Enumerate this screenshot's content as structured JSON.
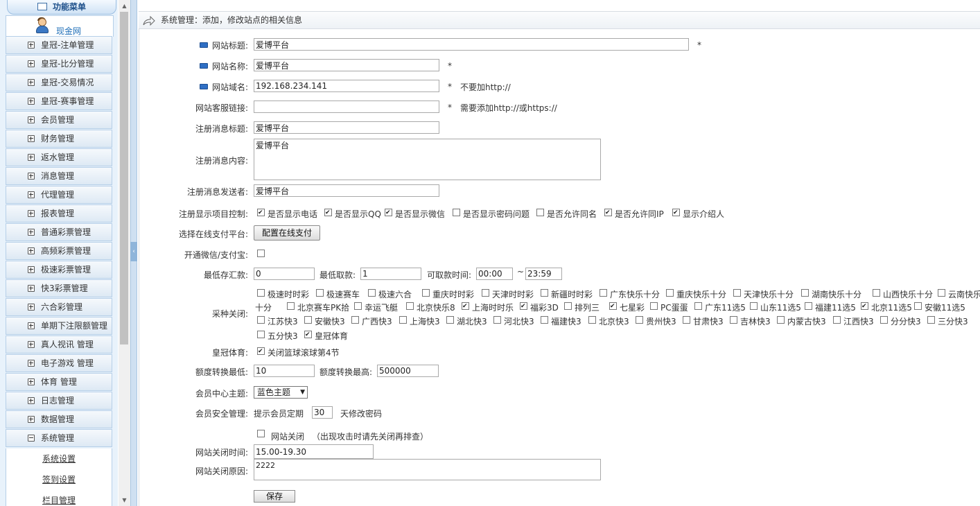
{
  "sidebar": {
    "header": "功能菜单",
    "user_name": "现金网",
    "items": [
      {
        "label": "皇冠-注单管理",
        "expanded": false
      },
      {
        "label": "皇冠-比分管理",
        "expanded": false
      },
      {
        "label": "皇冠-交易情况",
        "expanded": false
      },
      {
        "label": "皇冠-赛事管理",
        "expanded": false
      },
      {
        "label": "会员管理",
        "expanded": false
      },
      {
        "label": "财务管理",
        "expanded": false
      },
      {
        "label": "返水管理",
        "expanded": false
      },
      {
        "label": "消息管理",
        "expanded": false
      },
      {
        "label": "代理管理",
        "expanded": false
      },
      {
        "label": "报表管理",
        "expanded": false
      },
      {
        "label": "普通彩票管理",
        "expanded": false
      },
      {
        "label": "高频彩票管理",
        "expanded": false
      },
      {
        "label": "极速彩票管理",
        "expanded": false
      },
      {
        "label": "快3彩票管理",
        "expanded": false
      },
      {
        "label": "六合彩管理",
        "expanded": false
      },
      {
        "label": "单期下注限额管理",
        "expanded": false
      },
      {
        "label": "真人视讯 管理",
        "expanded": false
      },
      {
        "label": "电子游戏 管理",
        "expanded": false
      },
      {
        "label": "体育 管理",
        "expanded": false
      },
      {
        "label": "日志管理",
        "expanded": false
      },
      {
        "label": "数据管理",
        "expanded": false
      },
      {
        "label": "系统管理",
        "expanded": true
      }
    ],
    "sub_items": [
      "系统设置",
      "签到设置",
      "栏目管理"
    ]
  },
  "titlebar": {
    "text": "系统管理：添加，修改站点的相关信息"
  },
  "form": {
    "site_title": {
      "label": "网站标题:",
      "value": "爱博平台",
      "mark": "*"
    },
    "site_name": {
      "label": "网站名称:",
      "value": "爱博平台",
      "mark": "*"
    },
    "site_domain": {
      "label": "网站域名:",
      "value": "192.168.234.141",
      "mark": "*",
      "hint": "不要加http://"
    },
    "service_link": {
      "label": "网站客服链接:",
      "value": "",
      "mark": "*",
      "hint": "需要添加http://或https://"
    },
    "reg_msg_title": {
      "label": "注册消息标题:",
      "value": "爱博平台"
    },
    "reg_msg_content": {
      "label": "注册消息内容:",
      "value": "爱博平台"
    },
    "reg_msg_sender": {
      "label": "注册消息发送者:",
      "value": "爱博平台"
    },
    "reg_display": {
      "label": "注册显示项目控制:",
      "options": [
        {
          "label": "是否显示电话",
          "checked": true
        },
        {
          "label": "是否显示QQ",
          "checked": true
        },
        {
          "label": "是否显示微信",
          "checked": true
        },
        {
          "label": "是否显示密码问题",
          "checked": false
        },
        {
          "label": "是否允许同名",
          "checked": false
        },
        {
          "label": "是否允许同IP",
          "checked": true
        },
        {
          "label": "显示介绍人",
          "checked": true
        }
      ]
    },
    "payment": {
      "label": "选择在线支付平台:",
      "button": "配置在线支付"
    },
    "wechat_alipay": {
      "label": "开通微信/支付宝:",
      "checked": false
    },
    "deposit": {
      "label": "最低存汇款:",
      "value": "0",
      "withdraw_label": "最低取款:",
      "withdraw_value": "1",
      "time_label": "可取款时间:",
      "time_from": "00:00",
      "time_sep": "~",
      "time_to": "23:59"
    },
    "lottery": {
      "label": "采种关闭:",
      "items": [
        {
          "label": "极速时时彩",
          "checked": false
        },
        {
          "label": "极速赛车",
          "checked": false
        },
        {
          "label": "极速六合",
          "checked": false
        },
        {
          "label": "重庆时时彩",
          "checked": false
        },
        {
          "label": "天津时时彩",
          "checked": false
        },
        {
          "label": "新疆时时彩",
          "checked": false
        },
        {
          "label": "广东快乐十分",
          "checked": false
        },
        {
          "label": "重庆快乐十分",
          "checked": false
        },
        {
          "label": "天津快乐十分",
          "checked": false
        },
        {
          "label": "湖南快乐十分",
          "checked": false
        },
        {
          "label": "山西快乐十分",
          "checked": false
        },
        {
          "label": "云南快乐十分",
          "checked": false
        },
        {
          "label": "北京赛车PK拾",
          "checked": false
        },
        {
          "label": "幸运飞艇",
          "checked": false
        },
        {
          "label": "北京快乐8",
          "checked": false
        },
        {
          "label": "上海时时乐",
          "checked": true
        },
        {
          "label": "福彩3D",
          "checked": true
        },
        {
          "label": "排列三",
          "checked": false
        },
        {
          "label": "七星彩",
          "checked": true
        },
        {
          "label": "PC蛋蛋",
          "checked": false
        },
        {
          "label": "广东11选5",
          "checked": false
        },
        {
          "label": "山东11选5",
          "checked": false
        },
        {
          "label": "福建11选5",
          "checked": false
        },
        {
          "label": "北京11选5",
          "checked": true
        },
        {
          "label": "安徽11选5",
          "checked": false
        },
        {
          "label": "江苏快3",
          "checked": false
        },
        {
          "label": "安徽快3",
          "checked": false
        },
        {
          "label": "广西快3",
          "checked": false
        },
        {
          "label": "上海快3",
          "checked": false
        },
        {
          "label": "湖北快3",
          "checked": false
        },
        {
          "label": "河北快3",
          "checked": false
        },
        {
          "label": "福建快3",
          "checked": false
        },
        {
          "label": "北京快3",
          "checked": false
        },
        {
          "label": "贵州快3",
          "checked": false
        },
        {
          "label": "甘肃快3",
          "checked": false
        },
        {
          "label": "吉林快3",
          "checked": false
        },
        {
          "label": "内蒙古快3",
          "checked": false
        },
        {
          "label": "江西快3",
          "checked": false
        },
        {
          "label": "分分快3",
          "checked": false
        },
        {
          "label": "三分快3",
          "checked": false
        },
        {
          "label": "五分快3",
          "checked": false
        },
        {
          "label": "皇冠体育",
          "checked": true
        }
      ]
    },
    "crown_sports": {
      "label": "皇冠体育:",
      "option": "关闭篮球滚球第4节",
      "checked": true
    },
    "quota": {
      "min_label": "额度转换最低:",
      "min_value": "10",
      "max_label": "额度转换最高:",
      "max_value": "500000"
    },
    "theme": {
      "label": "会员中心主题:",
      "value": "蓝色主题"
    },
    "security": {
      "label": "会员安全管理:",
      "prefix": "提示会员定期",
      "days": "30",
      "suffix": "天修改密码"
    },
    "site_close": {
      "label": "网站关闭",
      "note": "（出现攻击时请先关闭再排查）",
      "checked": false
    },
    "close_time": {
      "label": "网站关闭时间:",
      "value": "15.00-19.30"
    },
    "close_reason": {
      "label": "网站关闭原因:",
      "value": "2222"
    },
    "save_button": "保存"
  }
}
